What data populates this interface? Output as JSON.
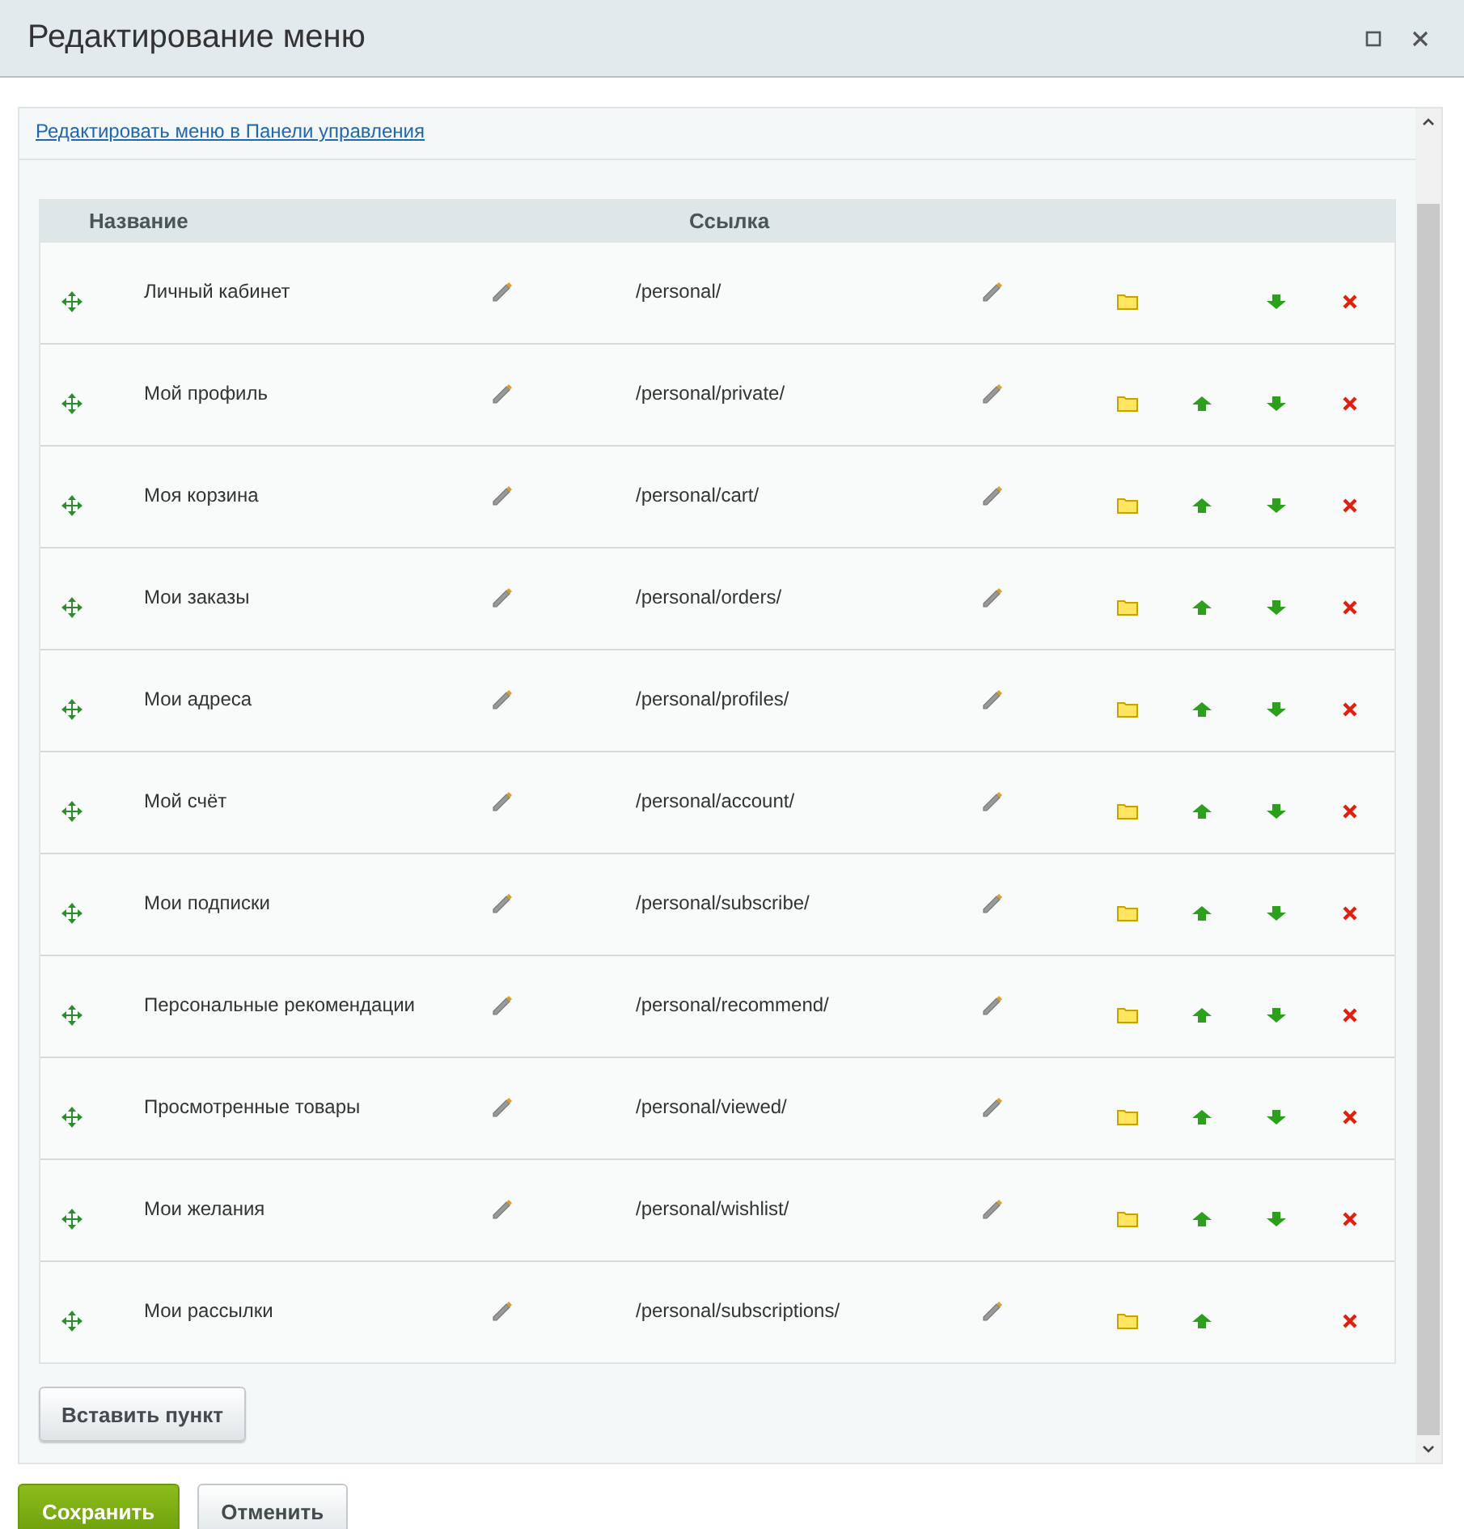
{
  "window": {
    "title": "Редактирование меню"
  },
  "panel_link": "Редактировать меню в Панели управления",
  "table": {
    "columns": [
      "Название",
      "Ссылка"
    ],
    "rows": [
      {
        "name": "Личный кабинет",
        "link": "/personal/",
        "can_move_up": false,
        "can_move_down": true
      },
      {
        "name": "Мой профиль",
        "link": "/personal/private/",
        "can_move_up": true,
        "can_move_down": true
      },
      {
        "name": "Моя корзина",
        "link": "/personal/cart/",
        "can_move_up": true,
        "can_move_down": true
      },
      {
        "name": "Мои заказы",
        "link": "/personal/orders/",
        "can_move_up": true,
        "can_move_down": true
      },
      {
        "name": "Мои адреса",
        "link": "/personal/profiles/",
        "can_move_up": true,
        "can_move_down": true
      },
      {
        "name": "Мой счёт",
        "link": "/personal/account/",
        "can_move_up": true,
        "can_move_down": true
      },
      {
        "name": "Мои подписки",
        "link": "/personal/subscribe/",
        "can_move_up": true,
        "can_move_down": true
      },
      {
        "name": "Персональные рекомендации",
        "link": "/personal/recommend/",
        "can_move_up": true,
        "can_move_down": true
      },
      {
        "name": "Просмотренные товары",
        "link": "/personal/viewed/",
        "can_move_up": true,
        "can_move_down": true
      },
      {
        "name": "Мои желания",
        "link": "/personal/wishlist/",
        "can_move_up": true,
        "can_move_down": true
      },
      {
        "name": "Мои рассылки",
        "link": "/personal/subscriptions/",
        "can_move_up": true,
        "can_move_down": false
      }
    ]
  },
  "add_button": "Вставить пункт",
  "buttons": [
    {
      "label": "Сохранить",
      "kind": "primary"
    },
    {
      "label": "Отменить",
      "kind": "secondary"
    }
  ]
}
